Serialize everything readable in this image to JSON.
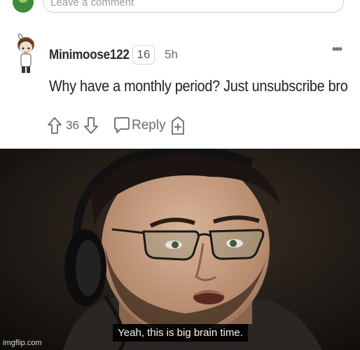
{
  "top": {
    "comment_placeholder": "Leave a comment"
  },
  "comment": {
    "username": "Minimoose122",
    "badge": "16",
    "time": "5h",
    "more": "•••",
    "body": "Why have a monthly period? Just unsubscribe bro",
    "vote_count": "36",
    "reply_label": "Reply",
    "icons": [
      "upvote-icon",
      "downvote-icon",
      "reply-icon",
      "award-icon",
      "more-icon"
    ]
  },
  "video": {
    "subtitle": "Yeah, this is big brain time.",
    "watermark": "imgflip.com"
  }
}
